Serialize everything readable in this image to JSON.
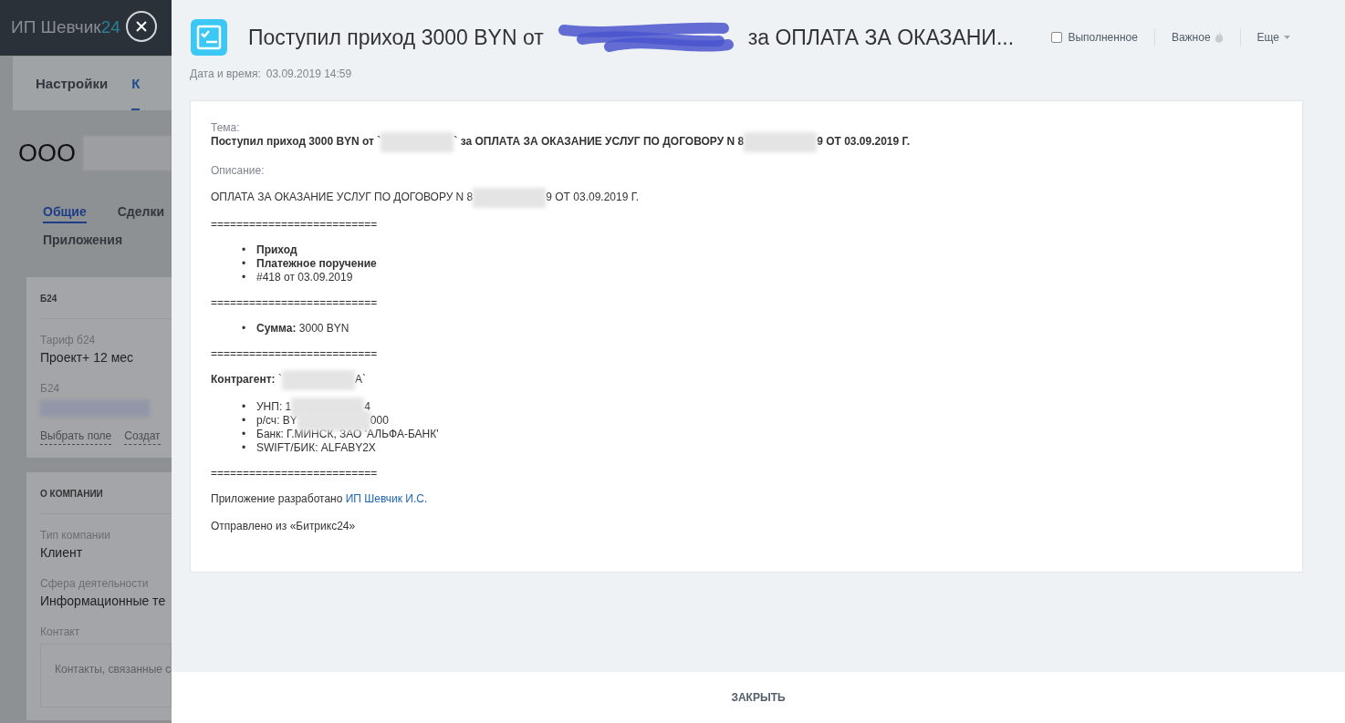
{
  "background_page": {
    "logo": "ИП Шевчик",
    "logo_suffix": "24",
    "tabs": [
      {
        "label": "Настройки",
        "selected": false
      },
      {
        "label": "К",
        "selected": true
      }
    ],
    "company": "ООО",
    "section_tabs": [
      {
        "label": "Общие",
        "selected": true
      },
      {
        "label": "Сделки",
        "selected": false
      },
      {
        "label": "Приложения",
        "selected": false
      }
    ],
    "cards": [
      {
        "title": "Б24",
        "fields": [
          {
            "label": "Тариф б24",
            "kind": "text",
            "value": "Проект+ 12 мес"
          },
          {
            "label": "Б24",
            "kind": "redacted"
          }
        ],
        "links": [
          "Выбрать поле",
          "Создат"
        ]
      },
      {
        "title": "О КОМПАНИИ",
        "fields": [
          {
            "label": "Тип компании",
            "kind": "text",
            "value": "Клиент"
          },
          {
            "label": "Сфера деятельности",
            "kind": "text",
            "value": "Информационные те"
          },
          {
            "label": "Контакт",
            "kind": "contact",
            "value": "Контакты, связанные с"
          }
        ]
      }
    ]
  },
  "panel": {
    "title": [
      {
        "kind": "text",
        "text": "Поступил приход 3000 BYN от"
      },
      {
        "kind": "scribble"
      },
      {
        "kind": "text",
        "text": "за ОПЛАТА ЗА ОКАЗАНИ..."
      }
    ],
    "completed": {
      "label": "Выполненное",
      "checked": false
    },
    "important": "Важное",
    "more": "Еще",
    "datetime_label": "Дата и время:",
    "datetime": "03.09.2019 14:59",
    "body": [
      {
        "kind": "subject",
        "label": "Тема:",
        "segments": [
          {
            "kind": "text",
            "text": "Поступил приход 3000 BYN от `"
          },
          {
            "kind": "redacted"
          },
          {
            "kind": "text",
            "text": "` за ОПЛАТА ЗА ОКАЗАНИЕ УСЛУГ ПО ДОГОВОРУ N 8"
          },
          {
            "kind": "redacted"
          },
          {
            "kind": "text",
            "text": "9 ОТ 03.09.2019 Г."
          }
        ]
      },
      {
        "kind": "label",
        "text": "Описание:"
      },
      {
        "kind": "paragraph",
        "segments": [
          {
            "kind": "text",
            "text": "ОПЛАТА ЗА ОКАЗАНИЕ УСЛУГ ПО ДОГОВОРУ N 8"
          },
          {
            "kind": "redacted"
          },
          {
            "kind": "text",
            "text": "9 ОТ 03.09.2019 Г."
          }
        ]
      },
      {
        "kind": "separator",
        "text": "=========================="
      },
      {
        "kind": "list",
        "items": [
          {
            "marker": "•",
            "segments": [
              {
                "kind": "bold",
                "text": "Приход"
              }
            ]
          },
          {
            "marker": "•",
            "segments": [
              {
                "kind": "bold",
                "text": "Платежное поручение"
              }
            ]
          },
          {
            "marker": "•",
            "segments": [
              {
                "kind": "text",
                "text": "#418 от 03.09.2019"
              }
            ]
          }
        ]
      },
      {
        "kind": "separator",
        "text": "=========================="
      },
      {
        "kind": "list",
        "items": [
          {
            "marker": "•",
            "segments": [
              {
                "kind": "bold",
                "text": "Сумма:"
              },
              {
                "kind": "text",
                "text": " 3000 BYN"
              }
            ]
          }
        ]
      },
      {
        "kind": "separator",
        "text": "=========================="
      },
      {
        "kind": "paragraph",
        "segments": [
          {
            "kind": "bold",
            "text": "Контрагент:"
          },
          {
            "kind": "text",
            "text": " `"
          },
          {
            "kind": "redacted"
          },
          {
            "kind": "text",
            "text": "А`"
          }
        ]
      },
      {
        "kind": "list",
        "items": [
          {
            "marker": "•",
            "segments": [
              {
                "kind": "text",
                "text": "УНП: 1"
              },
              {
                "kind": "redacted"
              },
              {
                "kind": "text",
                "text": "4"
              }
            ]
          },
          {
            "marker": "•",
            "segments": [
              {
                "kind": "text",
                "text": "р/сч: BY"
              },
              {
                "kind": "redacted"
              },
              {
                "kind": "text",
                "text": "000"
              }
            ]
          },
          {
            "marker": "•",
            "segments": [
              {
                "kind": "text",
                "text": "Банк: Г.МИНСК, ЗАО 'АЛЬФА-БАНК'"
              }
            ]
          },
          {
            "marker": "•",
            "segments": [
              {
                "kind": "text",
                "text": "SWIFT/БИК: ALFABY2X"
              }
            ]
          }
        ]
      },
      {
        "kind": "separator",
        "text": "=========================="
      },
      {
        "kind": "paragraph",
        "segments": [
          {
            "kind": "text",
            "text": "Приложение разработано "
          },
          {
            "kind": "link",
            "text": "ИП Шевчик И.С."
          }
        ]
      },
      {
        "kind": "paragraph",
        "segments": [
          {
            "kind": "text",
            "text": "Отправлено из «Битрикс24»"
          }
        ]
      }
    ],
    "close_button": "ЗАКРЫТЬ"
  }
}
